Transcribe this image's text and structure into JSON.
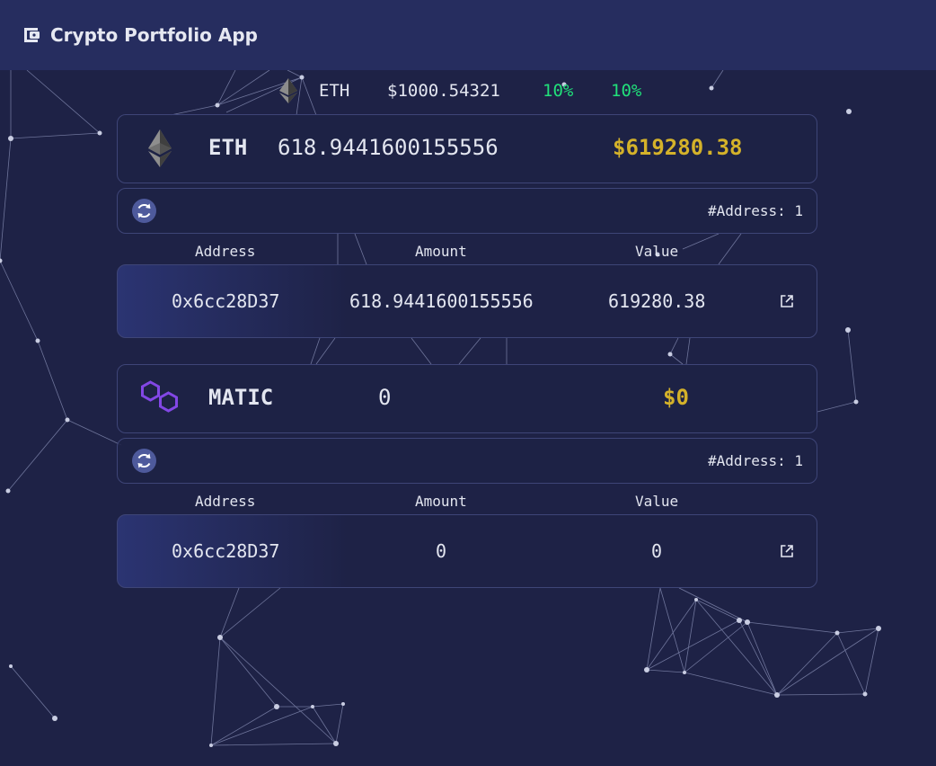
{
  "app": {
    "title": "Crypto Portfolio App"
  },
  "ticker": {
    "symbol": "ETH",
    "price": "$1000.54321",
    "change_1": "10%",
    "change_2": "10%"
  },
  "assets": [
    {
      "symbol": "ETH",
      "amount": "618.9441600155556",
      "value": "$619280.38",
      "address_count": "#Address: 1",
      "headers": {
        "address": "Address",
        "amount": "Amount",
        "value": "Value"
      },
      "rows": [
        {
          "address": "0x6cc28D37",
          "amount": "618.9441600155556",
          "value": "619280.38"
        }
      ]
    },
    {
      "symbol": "MATIC",
      "amount": "0",
      "value": "$0",
      "address_count": "#Address: 1",
      "headers": {
        "address": "Address",
        "amount": "Amount",
        "value": "Value"
      },
      "rows": [
        {
          "address": "0x6cc28D37",
          "amount": "0",
          "value": "0"
        }
      ]
    }
  ],
  "colors": {
    "background": "#1e2246",
    "header": "#262d5f",
    "gold": "#d4b22a",
    "green": "#21e07a",
    "matic": "#8247e5"
  },
  "icons": [
    "wallet-icon",
    "eth-icon",
    "matic-icon",
    "refresh-icon",
    "external-link-icon"
  ]
}
